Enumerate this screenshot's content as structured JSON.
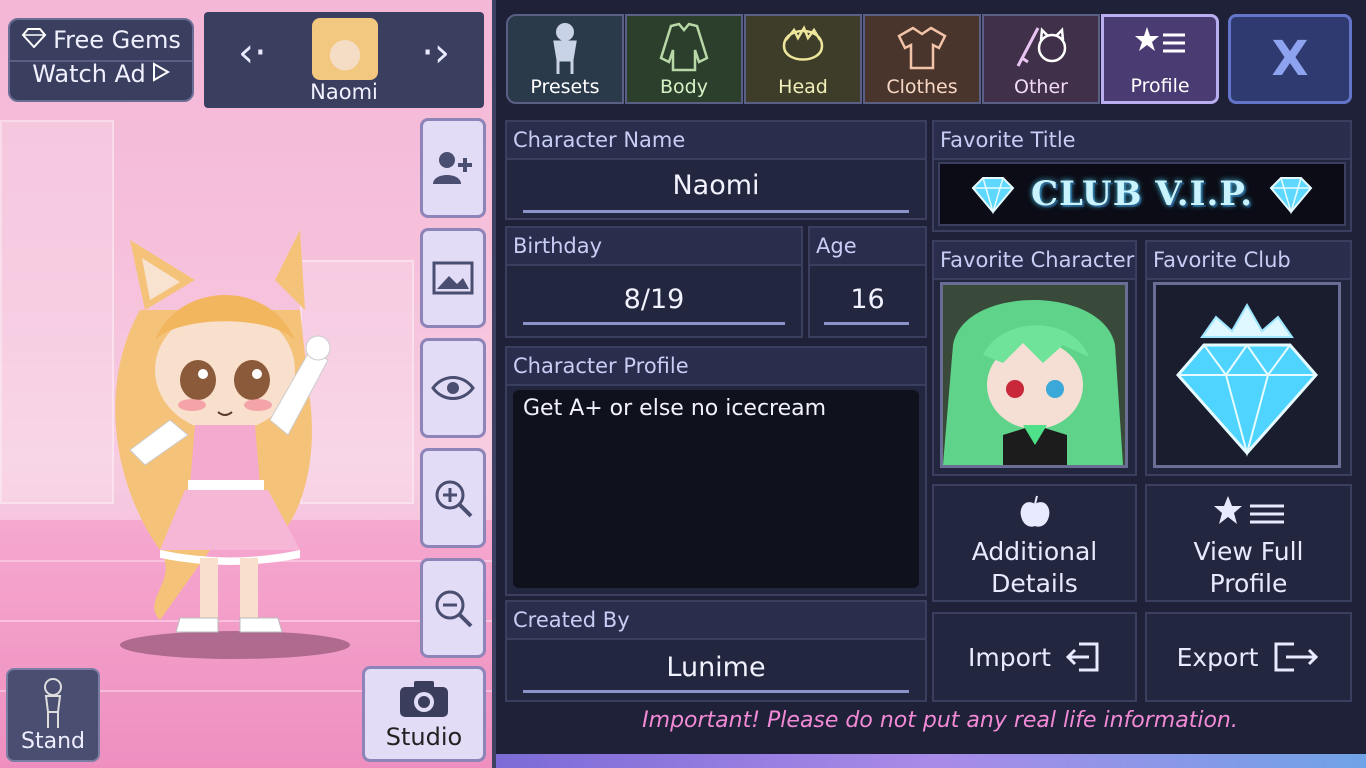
{
  "gems": {
    "line1": "Free Gems",
    "line2": "Watch Ad"
  },
  "character_selector": {
    "name": "Naomi"
  },
  "left_buttons": {
    "stand": "Stand",
    "studio": "Studio"
  },
  "tabs": [
    {
      "label": "Presets",
      "icon": "preset-figure-icon"
    },
    {
      "label": "Body",
      "icon": "body-icon"
    },
    {
      "label": "Head",
      "icon": "head-icon"
    },
    {
      "label": "Clothes",
      "icon": "shirt-icon"
    },
    {
      "label": "Other",
      "icon": "sword-cat-icon"
    },
    {
      "label": "Profile",
      "icon": "star-list-icon"
    }
  ],
  "close_label": "X",
  "fields": {
    "character_name": {
      "label": "Character Name",
      "value": "Naomi"
    },
    "birthday": {
      "label": "Birthday",
      "value": "8/19"
    },
    "age": {
      "label": "Age",
      "value": "16"
    },
    "character_profile": {
      "label": "Character Profile",
      "value": "Get A+ or else no icecream"
    },
    "created_by": {
      "label": "Created By",
      "value": "Lunime"
    },
    "favorite_title": {
      "label": "Favorite Title",
      "value": "CLUB V.I.P."
    },
    "favorite_character": {
      "label": "Favorite Character"
    },
    "favorite_club": {
      "label": "Favorite Club"
    }
  },
  "actions": {
    "additional_details": "Additional Details",
    "view_full_profile": "View Full Profile",
    "import": "Import",
    "export": "Export"
  },
  "notice": "Important! Please do not put any real life information."
}
